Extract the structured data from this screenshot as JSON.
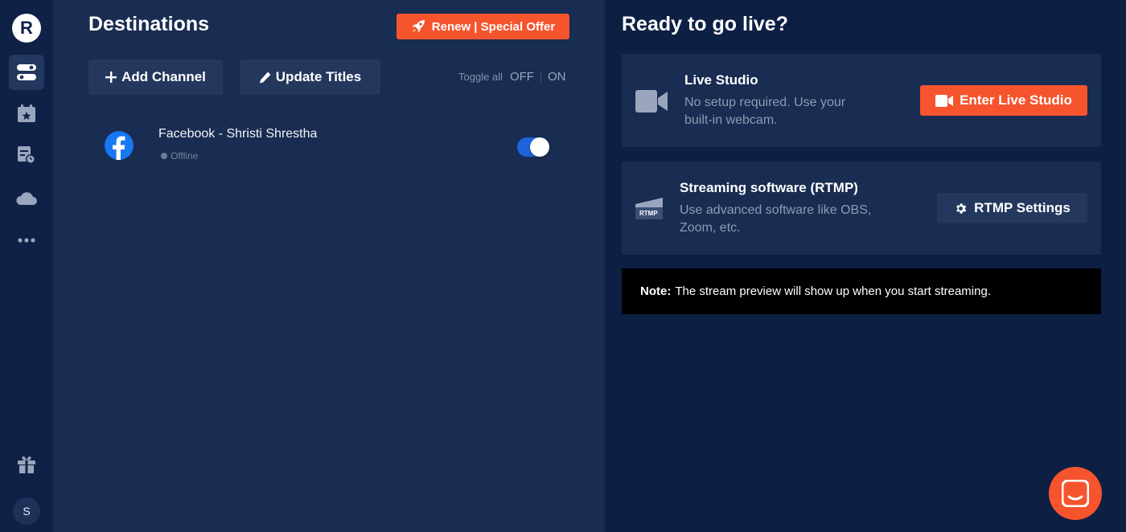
{
  "sidebar": {
    "logo_letter": "R",
    "avatar_initial": "S",
    "items": [
      {
        "icon": "toggles-icon",
        "active": true
      },
      {
        "icon": "calendar-star-icon",
        "active": false
      },
      {
        "icon": "schedule-clock-icon",
        "active": false
      },
      {
        "icon": "cloud-icon",
        "active": false
      },
      {
        "icon": "more-dots-icon",
        "active": false
      },
      {
        "icon": "gift-icon",
        "active": false
      }
    ]
  },
  "destinations": {
    "title": "Destinations",
    "renew_label": "Renew | Special Offer",
    "add_channel_label": "Add Channel",
    "update_titles_label": "Update Titles",
    "toggle_all_label": "Toggle all",
    "toggle_off_label": "OFF",
    "toggle_on_label": "ON",
    "channels": [
      {
        "name": "Facebook - Shristi Shrestha",
        "status": "Offline",
        "platform_icon": "facebook-icon",
        "enabled": true
      }
    ]
  },
  "live": {
    "title": "Ready to go live?",
    "studio": {
      "title": "Live Studio",
      "desc_line1": "No setup required. Use your",
      "desc_line2": "built-in webcam.",
      "button_label": "Enter Live Studio"
    },
    "rtmp": {
      "title": "Streaming software (RTMP)",
      "desc_line1": "Use advanced software like OBS,",
      "desc_line2": "Zoom, etc.",
      "icon_text": "RTMP",
      "button_label": "RTMP Settings"
    },
    "note": {
      "label": "Note:",
      "text": "The stream preview will show up when you start streaming."
    }
  },
  "colors": {
    "accent": "#f6542d",
    "rail_bg": "#0f2147",
    "panel_bg": "#192c51",
    "page_bg": "#0e1f44",
    "toggle_on": "#1f63db"
  }
}
